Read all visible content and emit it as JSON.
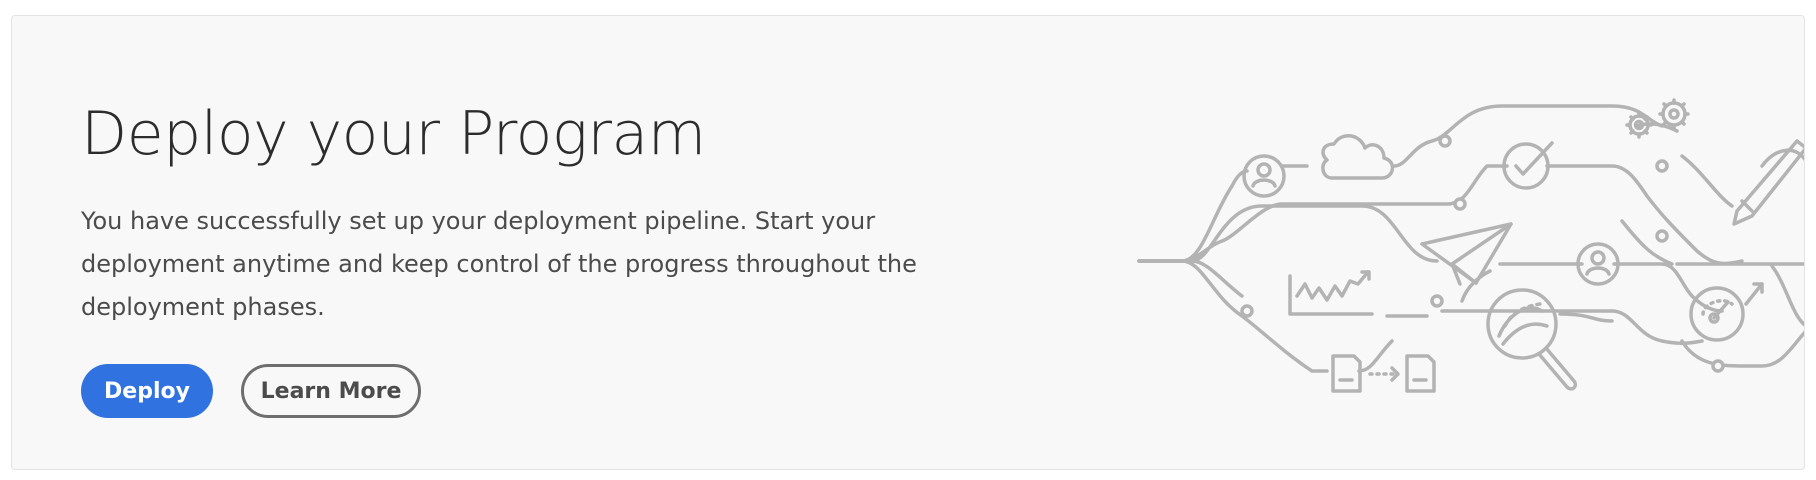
{
  "card": {
    "title": "Deploy your Program",
    "description": "You have successfully set up your deployment pipeline. Start your deployment anytime and keep control of the progress throughout the deployment phases.",
    "buttons": {
      "deploy_label": "Deploy",
      "learn_more_label": "Learn More"
    }
  },
  "colors": {
    "primary": "#2f72e0",
    "illustration_stroke": "#b3b3b3"
  },
  "illustration": {
    "icons": [
      "user-icon",
      "cloud-icon",
      "checkmark-icon",
      "gear-icon",
      "pen-icon",
      "paper-plane-icon",
      "line-chart-icon",
      "magnifier-icon",
      "gauge-icon",
      "document-icon"
    ]
  }
}
